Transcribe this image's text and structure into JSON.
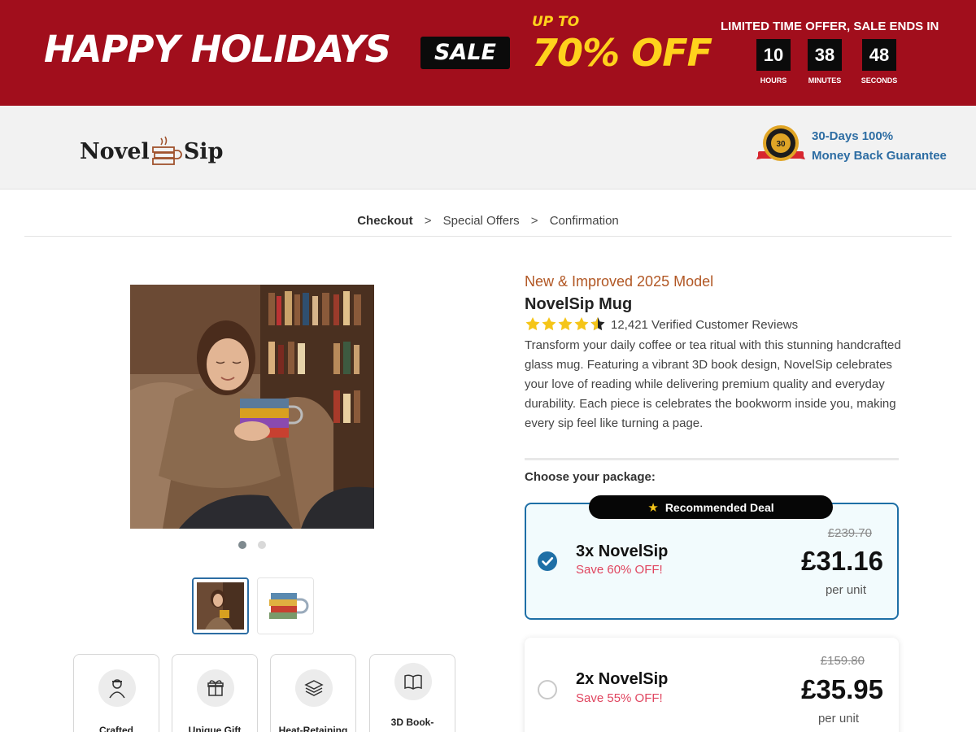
{
  "banner": {
    "headline": "HAPPY HOLIDAYS",
    "sale_badge": "SALE",
    "up_to": "UP TO",
    "discount": "70% OFF",
    "limited_text": "LIMITED TIME OFFER, SALE ENDS IN",
    "countdown": {
      "hours": "10",
      "minutes": "38",
      "seconds": "48",
      "hours_label": "HOURS",
      "minutes_label": "MINUTES",
      "seconds_label": "SECONDS"
    },
    "bg_color": "#a10e1c",
    "accent_color": "#ffd21c"
  },
  "header": {
    "logo_left": "Novel",
    "logo_right": "Sip",
    "logo_icon": "book-mug-icon",
    "guarantee_icon": "money-back-seal-icon",
    "guarantee_line1": "30-Days 100%",
    "guarantee_line2": "Money Back Guarantee"
  },
  "breadcrumb": {
    "items": [
      "Checkout",
      "Special Offers",
      "Confirmation"
    ],
    "separator": ">"
  },
  "gallery": {
    "main_image": "woman-holding-book-mug-photo",
    "thumbnails": [
      "woman-holding-book-mug-thumb",
      "book-mug-product-thumb"
    ],
    "active_index": 0
  },
  "features": [
    {
      "icon": "craftsman-icon",
      "label": "Crafted"
    },
    {
      "icon": "gift-icon",
      "label": "Unique Gift"
    },
    {
      "icon": "layers-icon",
      "label": "Heat-Retaining"
    },
    {
      "icon": "open-book-icon",
      "label": "3D Book-"
    }
  ],
  "product": {
    "subtitle": "New & Improved 2025 Model",
    "title": "NovelSip Mug",
    "rating": 4.5,
    "reviews": "12,421 Verified Customer Reviews",
    "description": "Transform your daily coffee or tea ritual with this stunning handcrafted glass mug. Featuring a vibrant 3D book design, NovelSip celebrates your love of reading while delivering premium quality and everyday durability. Each piece is celebrates the bookworm inside you, making every sip feel like turning a page.",
    "choose_label": "Choose your package:"
  },
  "packages": [
    {
      "badge": "Recommended Deal",
      "name": "3x NovelSip",
      "save": "Save 60% OFF!",
      "old_price": "£239.70",
      "price": "£31.16",
      "per_unit": "per unit",
      "selected": true
    },
    {
      "name": "2x NovelSip",
      "save": "Save 55% OFF!",
      "old_price": "£159.80",
      "price": "£35.95",
      "per_unit": "per unit",
      "selected": false
    }
  ]
}
